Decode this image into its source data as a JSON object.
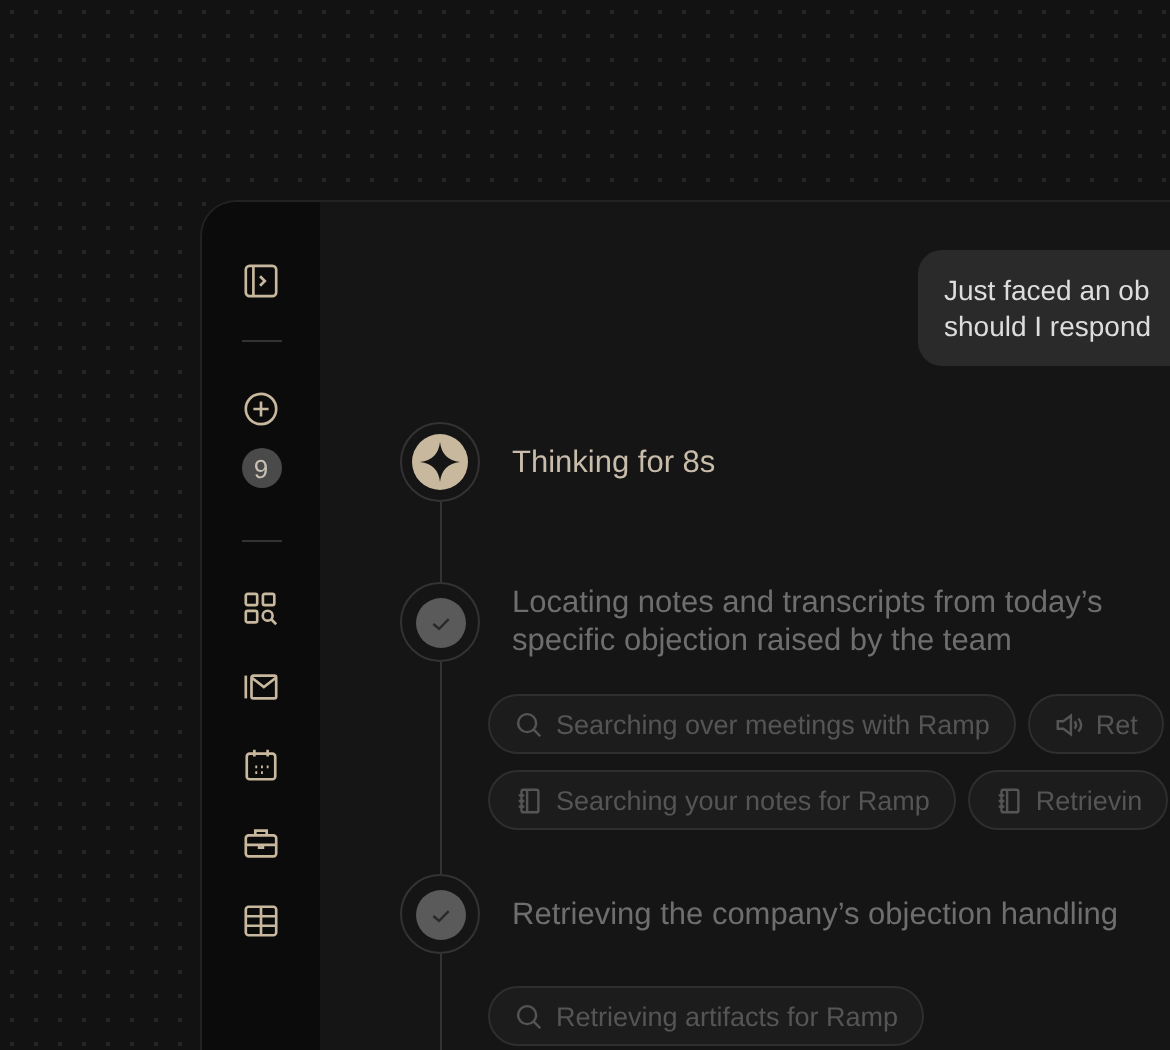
{
  "sidebar": {
    "badge": "9"
  },
  "message": {
    "lines": [
      "Just faced an ob",
      "should I respond"
    ]
  },
  "steps": [
    {
      "kind": "thinking",
      "title": [
        "Thinking for 8s"
      ]
    },
    {
      "kind": "done",
      "title": [
        "Locating notes and transcripts from today’s",
        "specific objection raised by the team"
      ],
      "chips": [
        {
          "kind": "search",
          "label": "Searching over meetings with Ramp"
        },
        {
          "kind": "audio",
          "label": "Ret"
        },
        {
          "kind": "notes",
          "label": "Searching your notes for Ramp"
        },
        {
          "kind": "notes",
          "label": "Retrievin"
        }
      ]
    },
    {
      "kind": "done",
      "title": [
        "Retrieving the company’s objection handling"
      ],
      "chips": [
        {
          "kind": "search",
          "label": "Retrieving artifacts for Ramp"
        }
      ]
    }
  ]
}
